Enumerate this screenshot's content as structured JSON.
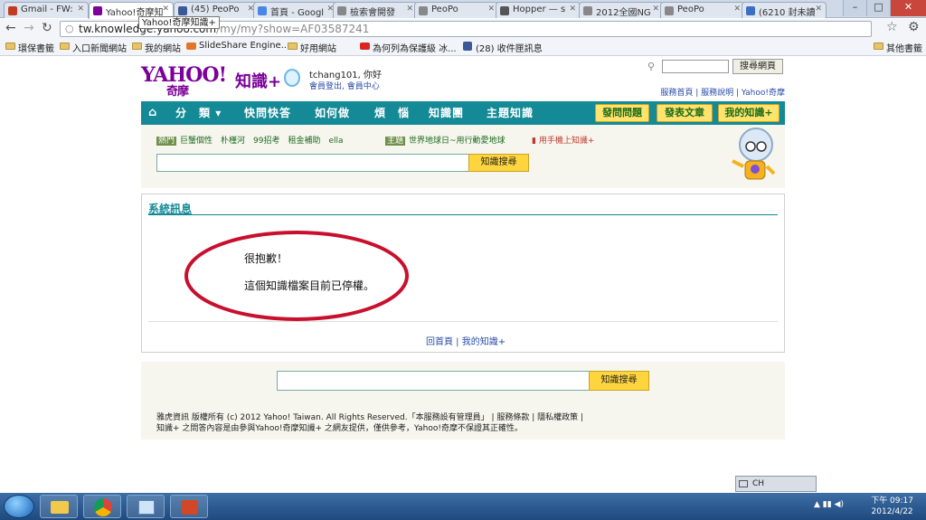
{
  "browser": {
    "tabs": [
      {
        "label": "Gmail - FW:",
        "icon": "gmail-icon",
        "color": "#c23b22",
        "active": false
      },
      {
        "label": "Yahoo!奇摩知",
        "icon": "yahoo-icon",
        "color": "#7b0099",
        "active": true
      },
      {
        "label": "(45) PeoPo",
        "icon": "facebook-icon",
        "color": "#3b5998",
        "active": false
      },
      {
        "label": "首頁 - Googl",
        "icon": "google-docs-icon",
        "color": "#4a86e8",
        "active": false
      },
      {
        "label": "檢索會開發",
        "icon": "peopo-icon",
        "color": "#888888",
        "active": false
      },
      {
        "label": "PeoPo",
        "icon": "peopo-icon",
        "color": "#888888",
        "active": false
      },
      {
        "label": "Hopper — s",
        "icon": "h-icon",
        "color": "#555555",
        "active": false
      },
      {
        "label": "2012全國NG",
        "icon": "peopo-icon",
        "color": "#888888",
        "active": false
      },
      {
        "label": "PeoPo",
        "icon": "peopo-icon",
        "color": "#888888",
        "active": false
      },
      {
        "label": "(6210 封未讀",
        "icon": "mail-icon",
        "color": "#3b6fc2",
        "active": false
      }
    ],
    "tooltip": "Yahoo!奇摩知識+",
    "url_host": "tw.knowledge.yahoo.com",
    "url_path": "/my/my?show=AF03587241",
    "bookmarks": [
      {
        "label": "環保書籤",
        "type": "folder"
      },
      {
        "label": "入口新聞網站",
        "type": "folder"
      },
      {
        "label": "我的網站",
        "type": "folder"
      },
      {
        "label": "SlideShare Engine...",
        "type": "slideshare"
      },
      {
        "label": "好用網站",
        "type": "folder"
      },
      {
        "label": "為何列為保護級 冰...",
        "type": "youtube"
      },
      {
        "label": "(28) 收件匣訊息",
        "type": "facebook"
      },
      {
        "label": "其他書籤",
        "type": "folder"
      }
    ]
  },
  "header": {
    "logo_yahoo": "YAHOO!",
    "logo_sub": "奇摩",
    "logo_product": "知識+",
    "greeting": "tchang101, 你好",
    "account_links": "會員登出, 會員中心",
    "search_button": "搜尋網頁",
    "top_links": "服務首頁 | 服務說明 | Yahoo!奇摩"
  },
  "nav": {
    "home_icon": "home-icon",
    "categories": "分　類",
    "items": [
      "快問快答",
      "如何做",
      "煩　惱",
      "知識團",
      "主題知識"
    ],
    "buttons": [
      "發問問題",
      "發表文章",
      "我的知識+"
    ]
  },
  "hot": {
    "tag_hot": "熱門",
    "hot_terms": "巨蟹個性　朴槿河　99招考　租金補助　ella",
    "tag_topic": "主題",
    "topic_text": "世界地球日~用行動愛地球",
    "mobile_link": "用手機上知識+",
    "search_button": "知識搜尋"
  },
  "message": {
    "title": "系統訊息",
    "sorry": "很抱歉！",
    "stopped": "這個知識檔案目前已停權。",
    "links": "回首頁 | 我的知識+"
  },
  "footer": {
    "search_button": "知識搜尋",
    "copyright": "雅虎資訊 版權所有 (c) 2012 Yahoo! Taiwan. All Rights Reserved.「本服務設有管理員」 | 服務條款 | 隱私權政策 |",
    "disclaimer": "知識+ 之問答內容是由參與Yahoo!奇摩知識+ 之網友提供，僅供參考，Yahoo!奇摩不保證其正確性。"
  },
  "system": {
    "ime_label": "CH",
    "time": "下午 09:17",
    "date": "2012/4/22"
  },
  "colors": {
    "teal_nav": "#138a96",
    "yahoo_purple": "#7b0099",
    "button_yellow": "#ffd53d",
    "annotation_red": "#c8102e"
  }
}
